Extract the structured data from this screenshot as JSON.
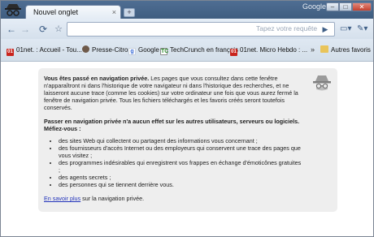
{
  "window": {
    "brand": "Google",
    "controls": {
      "minimize": "–",
      "maximize": "□",
      "close": "✕"
    }
  },
  "tabs": [
    {
      "label": "Nouvel onglet",
      "close": "×"
    }
  ],
  "new_tab": "+",
  "toolbar": {
    "back": "←",
    "forward": "→",
    "reload": "⟳",
    "star": "☆",
    "omnibox_value": "",
    "omnibox_placeholder": "Tapez votre requête",
    "go": "▶",
    "page_menu": "▭▾",
    "tools_menu": "✎▾"
  },
  "bookmarks": [
    {
      "label": "01net. : Accueil - Tou...",
      "icon": "01net-favicon",
      "fav": "01"
    },
    {
      "label": "Presse-Citron",
      "icon": "presse-citron-favicon",
      "fav": ""
    },
    {
      "label": "Google",
      "icon": "google-favicon",
      "fav": "g"
    },
    {
      "label": "TechCrunch en français",
      "icon": "techcrunch-favicon",
      "fav": "TC"
    },
    {
      "label": "01net. Micro Hebdo : ...",
      "icon": "01net-favicon",
      "fav": "01"
    }
  ],
  "bookmarks_overflow": "»",
  "other_bookmarks": "Autres favoris",
  "incognito": {
    "intro_bold": "Vous êtes passé en navigation privée.",
    "intro_rest": " Les pages que vous consultez dans cette fenêtre n'apparaîtront ni dans l'historique de votre navigateur ni dans l'historique des recherches, et ne laisseront aucune trace (comme les cookies) sur votre ordinateur une fois que vous aurez fermé la fenêtre de navigation privée. Tous les fichiers téléchargés et les favoris créés seront toutefois conservés.",
    "warning_heading": "Passer en navigation privée n'a aucun effet sur les autres utilisateurs, serveurs ou logiciels. Méfiez-vous :",
    "bullets": [
      "des sites Web qui collectent ou partagent des informations vous concernant ;",
      "des fournisseurs d'accès Internet ou des employeurs qui conservent une trace des pages que vous visitez ;",
      "des programmes indésirables qui enregistrent vos frappes en échange d'émoticônes gratuites ;",
      "des agents secrets ;",
      "des personnes qui se tiennent derrière vous."
    ],
    "learn_more_link": "En savoir plus",
    "learn_more_rest": " sur la navigation privée."
  },
  "colors": {
    "tabstrip": "#4f6e93",
    "toolbar": "#dfe8f2",
    "panel": "#eeeeee",
    "link": "#2233bb"
  }
}
